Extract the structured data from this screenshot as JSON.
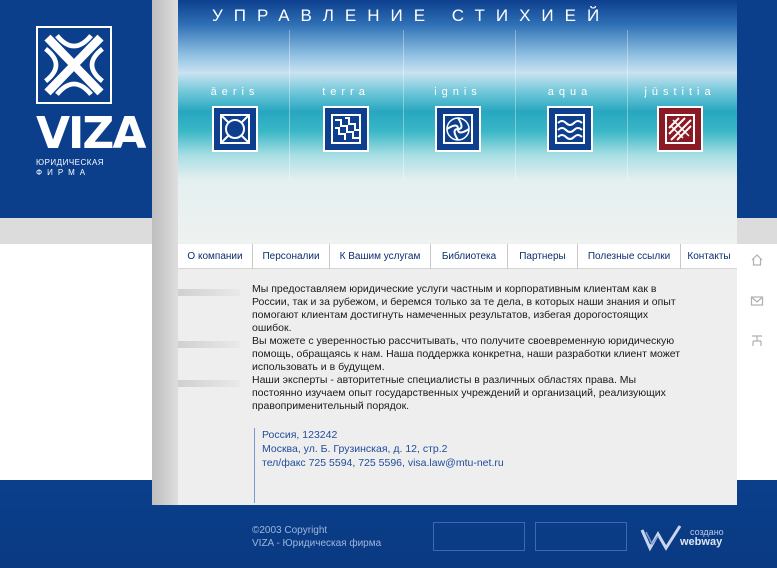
{
  "brand": {
    "name": "VIZA",
    "sub1": "ЮРИДИЧЕСКАЯ",
    "sub2": "ФИРМА"
  },
  "banner": {
    "title": "УПРАВЛЕНИЕ СТИХИЕЙ",
    "elements": [
      {
        "label": "āeris",
        "icon": "aeris-icon"
      },
      {
        "label": "terra",
        "icon": "terra-icon"
      },
      {
        "label": "ignis",
        "icon": "ignis-icon"
      },
      {
        "label": "aqua",
        "icon": "aqua-icon"
      },
      {
        "label": "jūstitia",
        "icon": "justitia-icon"
      }
    ]
  },
  "nav": [
    "О компании",
    "Персоналии",
    "К Вашим услугам",
    "Библиотека",
    "Партнеры",
    "Полезные ссылки",
    "Контакты"
  ],
  "content": {
    "p1": "Мы предоставляем юридические услуги частным и корпоративным клиентам как в России, так и за рубежом, и беремся только за те дела, в которых наши знания и опыт помогают клиентам достигнуть намеченных результатов, избегая дорогостоящих ошибок.",
    "p2": "Вы можете с уверенностью рассчитывать, что получите своевременную юридическую помощь, обращаясь к нам. Наша поддержка конкретна, наши разработки клиент может использовать и в будущем.",
    "p3": "Наши эксперты - авторитетные специалисты в различных областях права. Мы постоянно изучаем опыт государственных учреждений и организаций, реализующих правоприменительный порядок."
  },
  "address": {
    "line1": "Россия, 123242",
    "line2": "Москва, ул. Б. Грузинская, д. 12, стр.2",
    "line3": "тел/факс 725 5594, 725 5596,  visa.law@mtu-net.ru"
  },
  "footer": {
    "copyright": "©2003 Copyright",
    "company": "VIZA - Юридическая фирма",
    "made_by_label": "создано",
    "made_by_name": "webway"
  },
  "colors": {
    "brand_blue": "#0b3f8c",
    "nav_text": "#0b2e6e",
    "address_blue": "#1f4c9c",
    "justitia_red": "#8c1a24"
  }
}
